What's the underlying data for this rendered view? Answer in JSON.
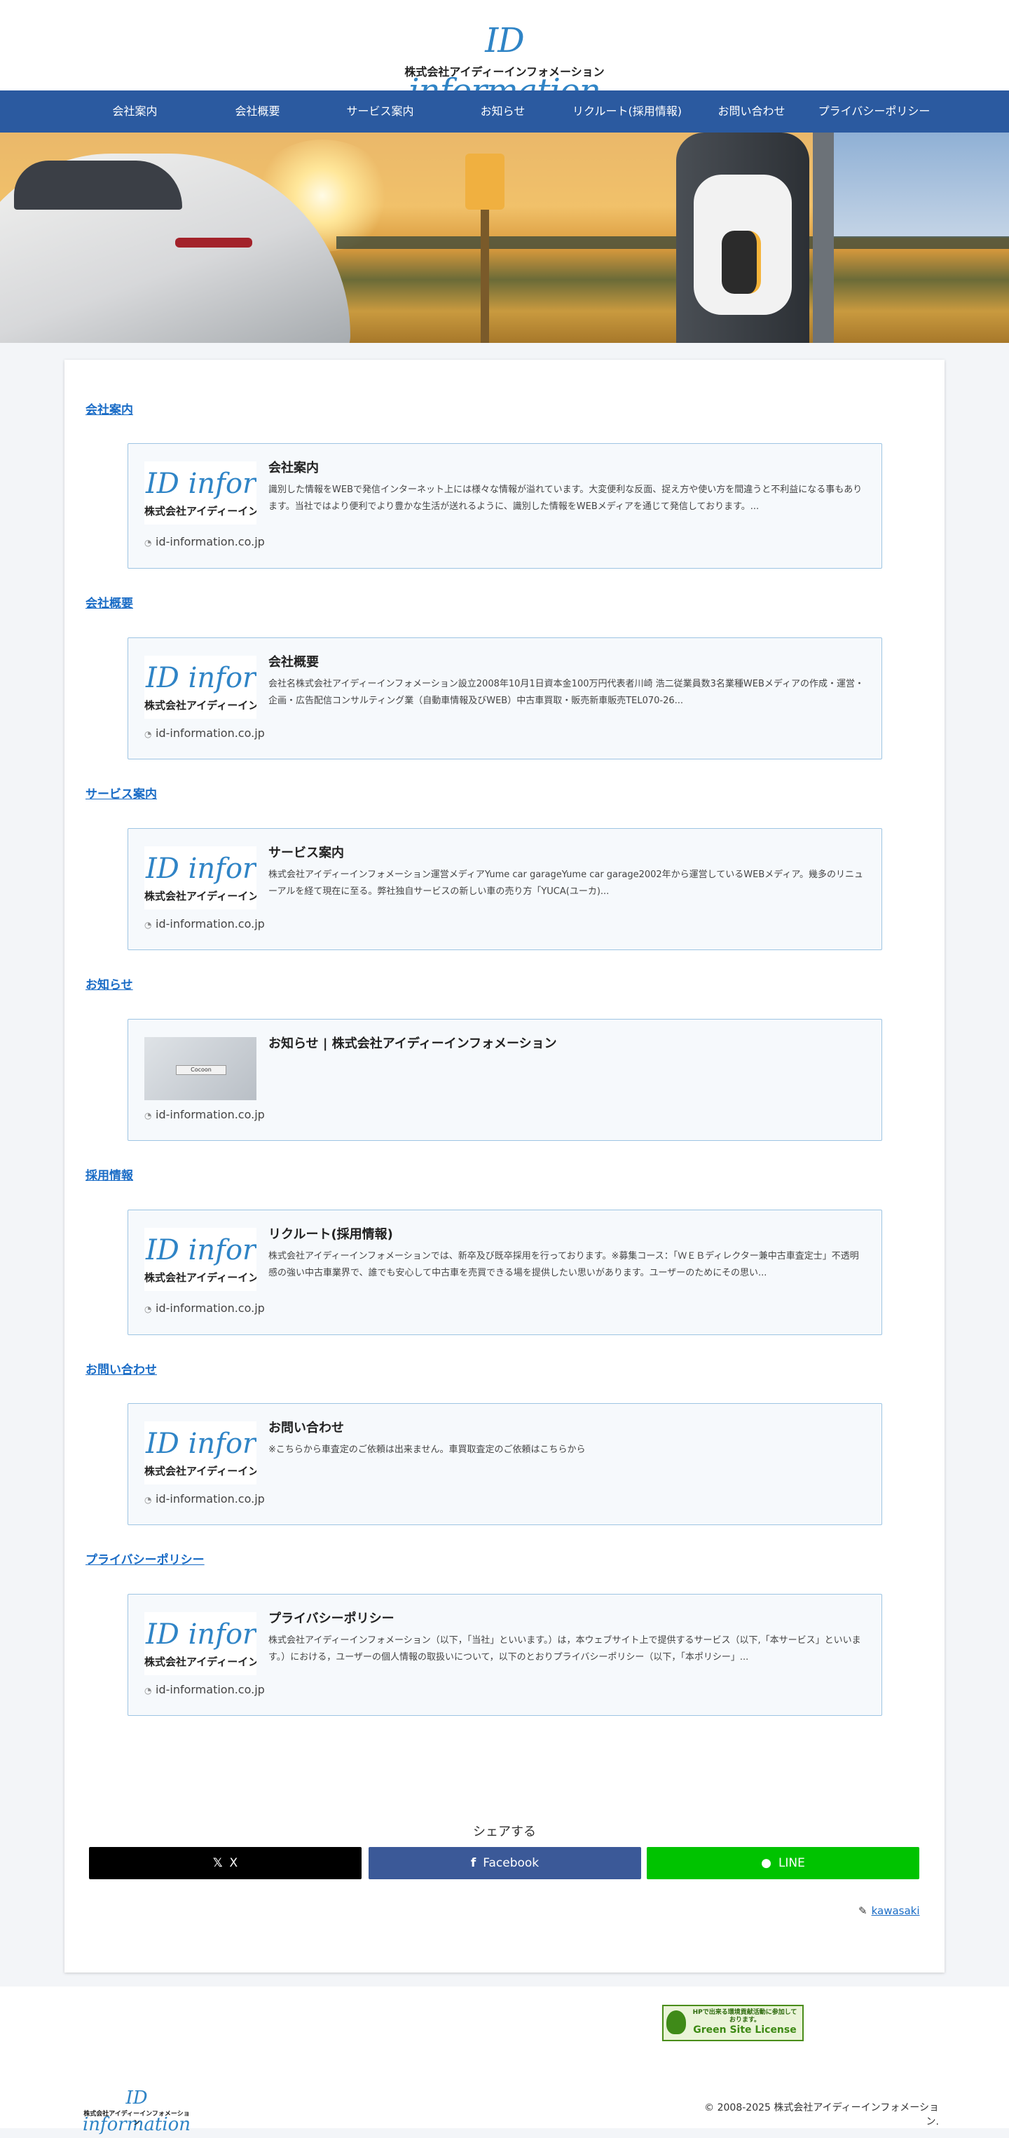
{
  "header": {
    "logo_script": "ID information",
    "logo_sub": "株式会社アイディーインフォメーション"
  },
  "nav": [
    {
      "label": "会社案内"
    },
    {
      "label": "会社概要"
    },
    {
      "label": "サービス案内"
    },
    {
      "label": "お知らせ"
    },
    {
      "label": "リクルート(採用情報)"
    },
    {
      "label": "お問い合わせ"
    },
    {
      "label": "プライバシーポリシー"
    }
  ],
  "sections": [
    {
      "heading": "会社案内",
      "card": {
        "title": "会社案内",
        "excerpt": "識別した情報をWEBで発信インターネット上には様々な情報が溢れています。大変便利な反面、捉え方や使い方を間違うと不利益になる事もあります。当社ではより便利でより豊かな生活が送れるように、識別した情報をWEBメディアを通じて発信しております。...",
        "domain": "id-information.co.jp",
        "thumb_script": "ID information",
        "thumb_sub": "株式会社アイディーインフォメーション"
      }
    },
    {
      "heading": "会社概要",
      "card": {
        "title": "会社概要",
        "excerpt": "会社名株式会社アイディーインフォメーション設立2008年10月1日資本金100万円代表者川崎 浩二従業員数3名業種WEBメディアの作成・運営・企画・広告配信コンサルティング業（自動車情報及びWEB）中古車買取・販売新車販売TEL070-26...",
        "domain": "id-information.co.jp",
        "thumb_script": "ID information",
        "thumb_sub": "株式会社アイディーインフォメーション"
      }
    },
    {
      "heading": "サービス案内",
      "card": {
        "title": "サービス案内",
        "excerpt": "株式会社アイディーインフォメーション運営メディアYume car garageYume car garage2002年から運営しているWEBメディア。幾多のリニューアルを経て現在に至る。弊社独自サービスの新しい車の売り方「YUCA(ユーカ)...",
        "domain": "id-information.co.jp",
        "thumb_script": "ID information",
        "thumb_sub": "株式会社アイディーインフォメーション"
      }
    },
    {
      "heading": "お知らせ",
      "card": {
        "title": "お知らせ | 株式会社アイディーインフォメーション",
        "excerpt": "",
        "domain": "id-information.co.jp",
        "thumb_alt_label": "Cocoon"
      }
    },
    {
      "heading": "採用情報",
      "card": {
        "title": "リクルート(採用情報)",
        "excerpt": "株式会社アイディーインフォメーションでは、新卒及び既卒採用を行っております。※募集コース：「ＷＥＢディレクター兼中古車査定士」不透明感の強い中古車業界で、誰でも安心して中古車を売買できる場を提供したい思いがあります。ユーザーのためにその思い...",
        "domain": "id-information.co.jp",
        "thumb_script": "ID information",
        "thumb_sub": "株式会社アイディーインフォメーション"
      }
    },
    {
      "heading": "お問い合わせ",
      "card": {
        "title": "お問い合わせ",
        "excerpt": "※こちらから車査定のご依頼は出来ません。車買取査定のご依頼はこちらから",
        "domain": "id-information.co.jp",
        "thumb_script": "ID information",
        "thumb_sub": "株式会社アイディーインフォメーション"
      }
    },
    {
      "heading": "プライバシーポリシー",
      "card": {
        "title": "プライバシーポリシー",
        "excerpt": "株式会社アイディーインフォメーション（以下，「当社」といいます。）は，本ウェブサイト上で提供するサービス（以下,「本サービス」といいます。）における，ユーザーの個人情報の取扱いについて，以下のとおりプライバシーポリシー（以下，「本ポリシー」...",
        "domain": "id-information.co.jp",
        "thumb_script": "ID information",
        "thumb_sub": "株式会社アイディーインフォメーション"
      }
    }
  ],
  "share": {
    "label": "シェアする",
    "buttons": [
      {
        "label": "X",
        "icon": "x-logo-icon",
        "glyph": "𝕏",
        "color": "#000000"
      },
      {
        "label": "Facebook",
        "icon": "facebook-icon",
        "glyph": "f",
        "color": "#3b5998"
      },
      {
        "label": "LINE",
        "icon": "line-icon",
        "glyph": "●",
        "color": "#00c300"
      }
    ]
  },
  "author": {
    "name": "kawasaki",
    "icon": "pencil-icon"
  },
  "footer": {
    "badge_top": "HPで出来る環境貢献活動に参加しております。",
    "badge_main": "Green Site License",
    "logo_script": "ID information",
    "logo_sub": "株式会社アイディーインフォメーション",
    "copyright": "© 2008-2025 株式会社アイディーインフォメーション."
  },
  "colors": {
    "nav_bg": "#2b5aa0",
    "link": "#1a6cc6",
    "card_border": "#9ec5e3",
    "card_bg": "#f6f9fc"
  }
}
